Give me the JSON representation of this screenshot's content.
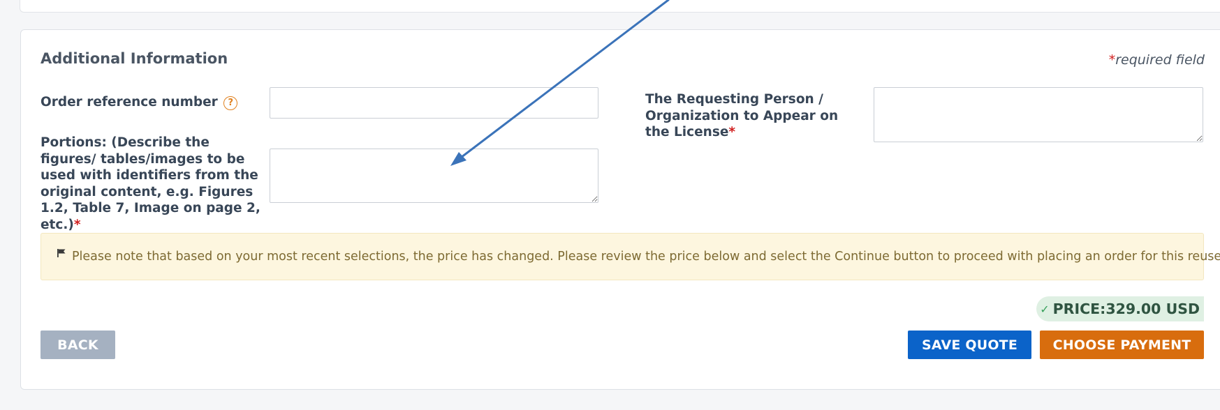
{
  "section": {
    "title": "Additional Information",
    "required_star": "*",
    "required_text": "required field"
  },
  "fields": {
    "order_ref": {
      "label": "Order reference number",
      "help_icon": "?",
      "value": ""
    },
    "portions": {
      "label": "Portions: (Describe the figures/ tables/images to be used with identifiers from the original content, e.g. Figures 1.2, Table 7, Image on page 2, etc.)",
      "required_star": "*",
      "value": ""
    },
    "requesting_person": {
      "label": "The Requesting Person / Organization to Appear on the License",
      "required_star": "*",
      "value": ""
    }
  },
  "notice": {
    "icon": "flag-icon",
    "text": "Please note that based on your most recent selections, the price has changed. Please review the price below and select the Continue button to proceed with placing an order for this reuse."
  },
  "price": {
    "icon": "check-icon",
    "label": "PRICE:",
    "amount": "329.00 USD"
  },
  "buttons": {
    "back": "BACK",
    "save_quote": "SAVE QUOTE",
    "choose_payment": "CHOOSE PAYMENT"
  },
  "colors": {
    "primary": "#0b63c9",
    "accent": "#d86d0e",
    "notice_bg": "#fdf6df",
    "price_bg": "#dff0e3",
    "required": "#d11f1f"
  }
}
